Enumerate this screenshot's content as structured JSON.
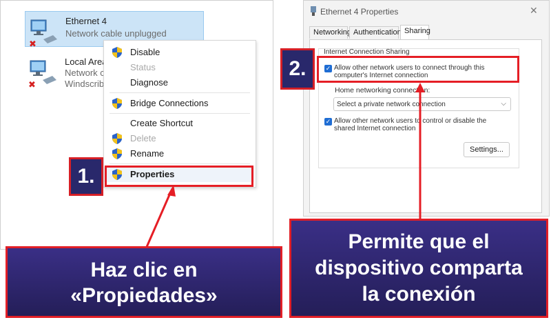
{
  "left_panel": {
    "adapters": [
      {
        "name": "Ethernet 4",
        "lines": [
          "Network cable unplugged"
        ]
      },
      {
        "name": "Local Area",
        "lines": [
          "Network c",
          "Windscrib"
        ]
      }
    ],
    "context_menu": [
      {
        "label": "Disable",
        "icon": "shield-icon",
        "enabled": true
      },
      {
        "label": "Status",
        "icon": "",
        "enabled": false
      },
      {
        "label": "Diagnose",
        "icon": "",
        "enabled": true
      },
      {
        "label": "Bridge Connections",
        "icon": "shield-icon",
        "enabled": true
      },
      {
        "label": "Create Shortcut",
        "icon": "",
        "enabled": true
      },
      {
        "label": "Delete",
        "icon": "shield-icon",
        "enabled": false
      },
      {
        "label": "Rename",
        "icon": "shield-icon",
        "enabled": true
      },
      {
        "label": "Properties",
        "icon": "shield-icon",
        "enabled": true,
        "bold": true
      }
    ]
  },
  "dialog": {
    "title": "Ethernet 4 Properties",
    "close": "✕",
    "tabs": [
      "Networking",
      "Authentication",
      "Sharing"
    ],
    "active_tab": "Sharing",
    "group_label": "Internet Connection Sharing",
    "allow_connect": {
      "checked": true,
      "line1": "Allow other network users to connect through this",
      "line2": "computer's Internet connection"
    },
    "home_label": "Home networking connection:",
    "select_value": "Select a private network connection",
    "allow_control": {
      "checked": true,
      "line1": "Allow other network users to control or disable the",
      "line2": "shared Internet connection"
    },
    "settings_button": "Settings..."
  },
  "annotations": {
    "step1": "1.",
    "step2": "2.",
    "callout_left": [
      "Haz clic en",
      "«Propiedades»"
    ],
    "callout_right": [
      "Permite que el",
      "dispositivo comparta",
      "la conexión"
    ],
    "accent_color": "#e51e25",
    "callout_color": "#2b2470"
  }
}
